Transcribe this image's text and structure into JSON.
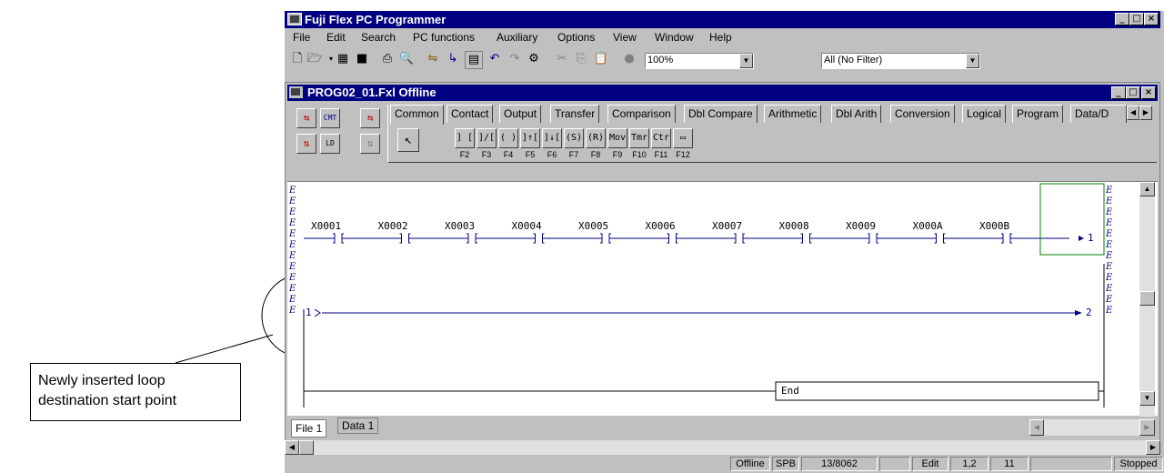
{
  "app": {
    "title": "Fuji Flex PC Programmer"
  },
  "menu": [
    "File",
    "Edit",
    "Search",
    "PC functions",
    "Auxiliary",
    "Options",
    "View",
    "Window",
    "Help"
  ],
  "toolbar": {
    "zoom": "100%",
    "filter": "All (No Filter)"
  },
  "child": {
    "title": "PROG02_01.Fxl Offline"
  },
  "instr_tabs": [
    "Common",
    "Contact",
    "Output",
    "Transfer",
    "Comparison",
    "Dbl Compare",
    "Arithmetic",
    "Dbl Arith",
    "Conversion",
    "Logical",
    "Program",
    "Data/D"
  ],
  "instr_buttons": [
    {
      "sym": "] [",
      "key": "F2"
    },
    {
      "sym": "]/[",
      "key": "F3"
    },
    {
      "sym": "( )",
      "key": "F4"
    },
    {
      "sym": "]↑[",
      "key": "F5"
    },
    {
      "sym": "]↓[",
      "key": "F6"
    },
    {
      "sym": "(S)",
      "key": "F7"
    },
    {
      "sym": "(R)",
      "key": "F8"
    },
    {
      "sym": "Mov",
      "key": "F9"
    },
    {
      "sym": "Tmr",
      "key": "F10"
    },
    {
      "sym": "Ctr",
      "key": "F11"
    },
    {
      "sym": "▭",
      "key": "F12"
    }
  ],
  "ladder": {
    "contacts": [
      "X0001",
      "X0002",
      "X0003",
      "X0004",
      "X0005",
      "X0006",
      "X0007",
      "X0008",
      "X0009",
      "X000A",
      "X000B"
    ],
    "loop_end": "1",
    "loop_start": "1",
    "jump_target": "2",
    "end_label": "End",
    "marker": "E"
  },
  "sheet_tabs": [
    "File 1",
    "Data 1"
  ],
  "status": [
    "Offline",
    "SPB",
    "13/8062",
    "",
    "Edit",
    "1,2",
    "11",
    "",
    "Stopped"
  ],
  "callout": {
    "text_line1": "Newly inserted loop",
    "text_line2": "destination start point"
  }
}
